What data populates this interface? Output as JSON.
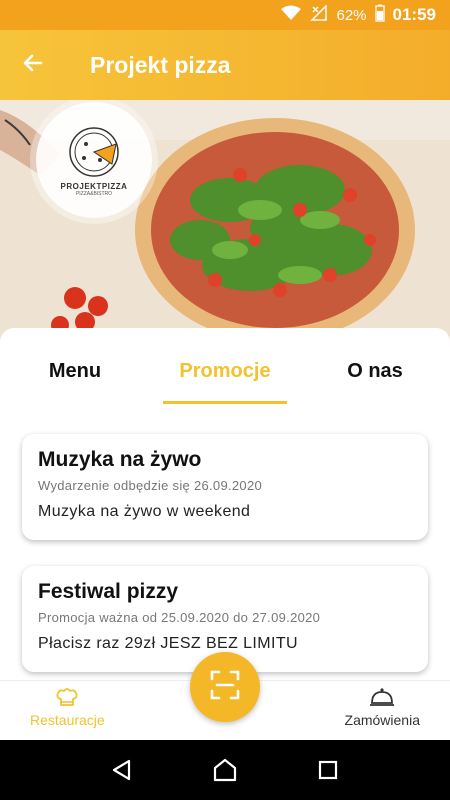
{
  "status_bar": {
    "battery": "62%",
    "time": "01:59"
  },
  "app_bar": {
    "title": "Projekt pizza"
  },
  "logo": {
    "name": "PROJEKTPIZZA",
    "sub": "PIZZA&BISTRO"
  },
  "tabs": [
    {
      "label": "Menu",
      "active": false
    },
    {
      "label": "Promocje",
      "active": true
    },
    {
      "label": "O nas",
      "active": false
    }
  ],
  "cards": [
    {
      "title": "Muzyka na żywo",
      "meta": "Wydarzenie odbędzie się 26.09.2020",
      "desc": "Muzyka na żywo w weekend"
    },
    {
      "title": "Festiwal pizzy",
      "meta": "Promocja ważna od 25.09.2020 do 27.09.2020",
      "desc": "Płacisz raz 29zł JESZ BEZ LIMITU"
    }
  ],
  "bottom_nav": {
    "left_label": "Restauracje",
    "right_label": "Zamówienia"
  },
  "colors": {
    "accent": "#f2c230",
    "appbar": "#f4b02c",
    "statusbar": "#f2a21c"
  },
  "icons": {
    "back": "arrow-left-icon",
    "scan": "scan-icon",
    "chef": "chef-hat-icon",
    "cloche": "cloche-icon"
  }
}
